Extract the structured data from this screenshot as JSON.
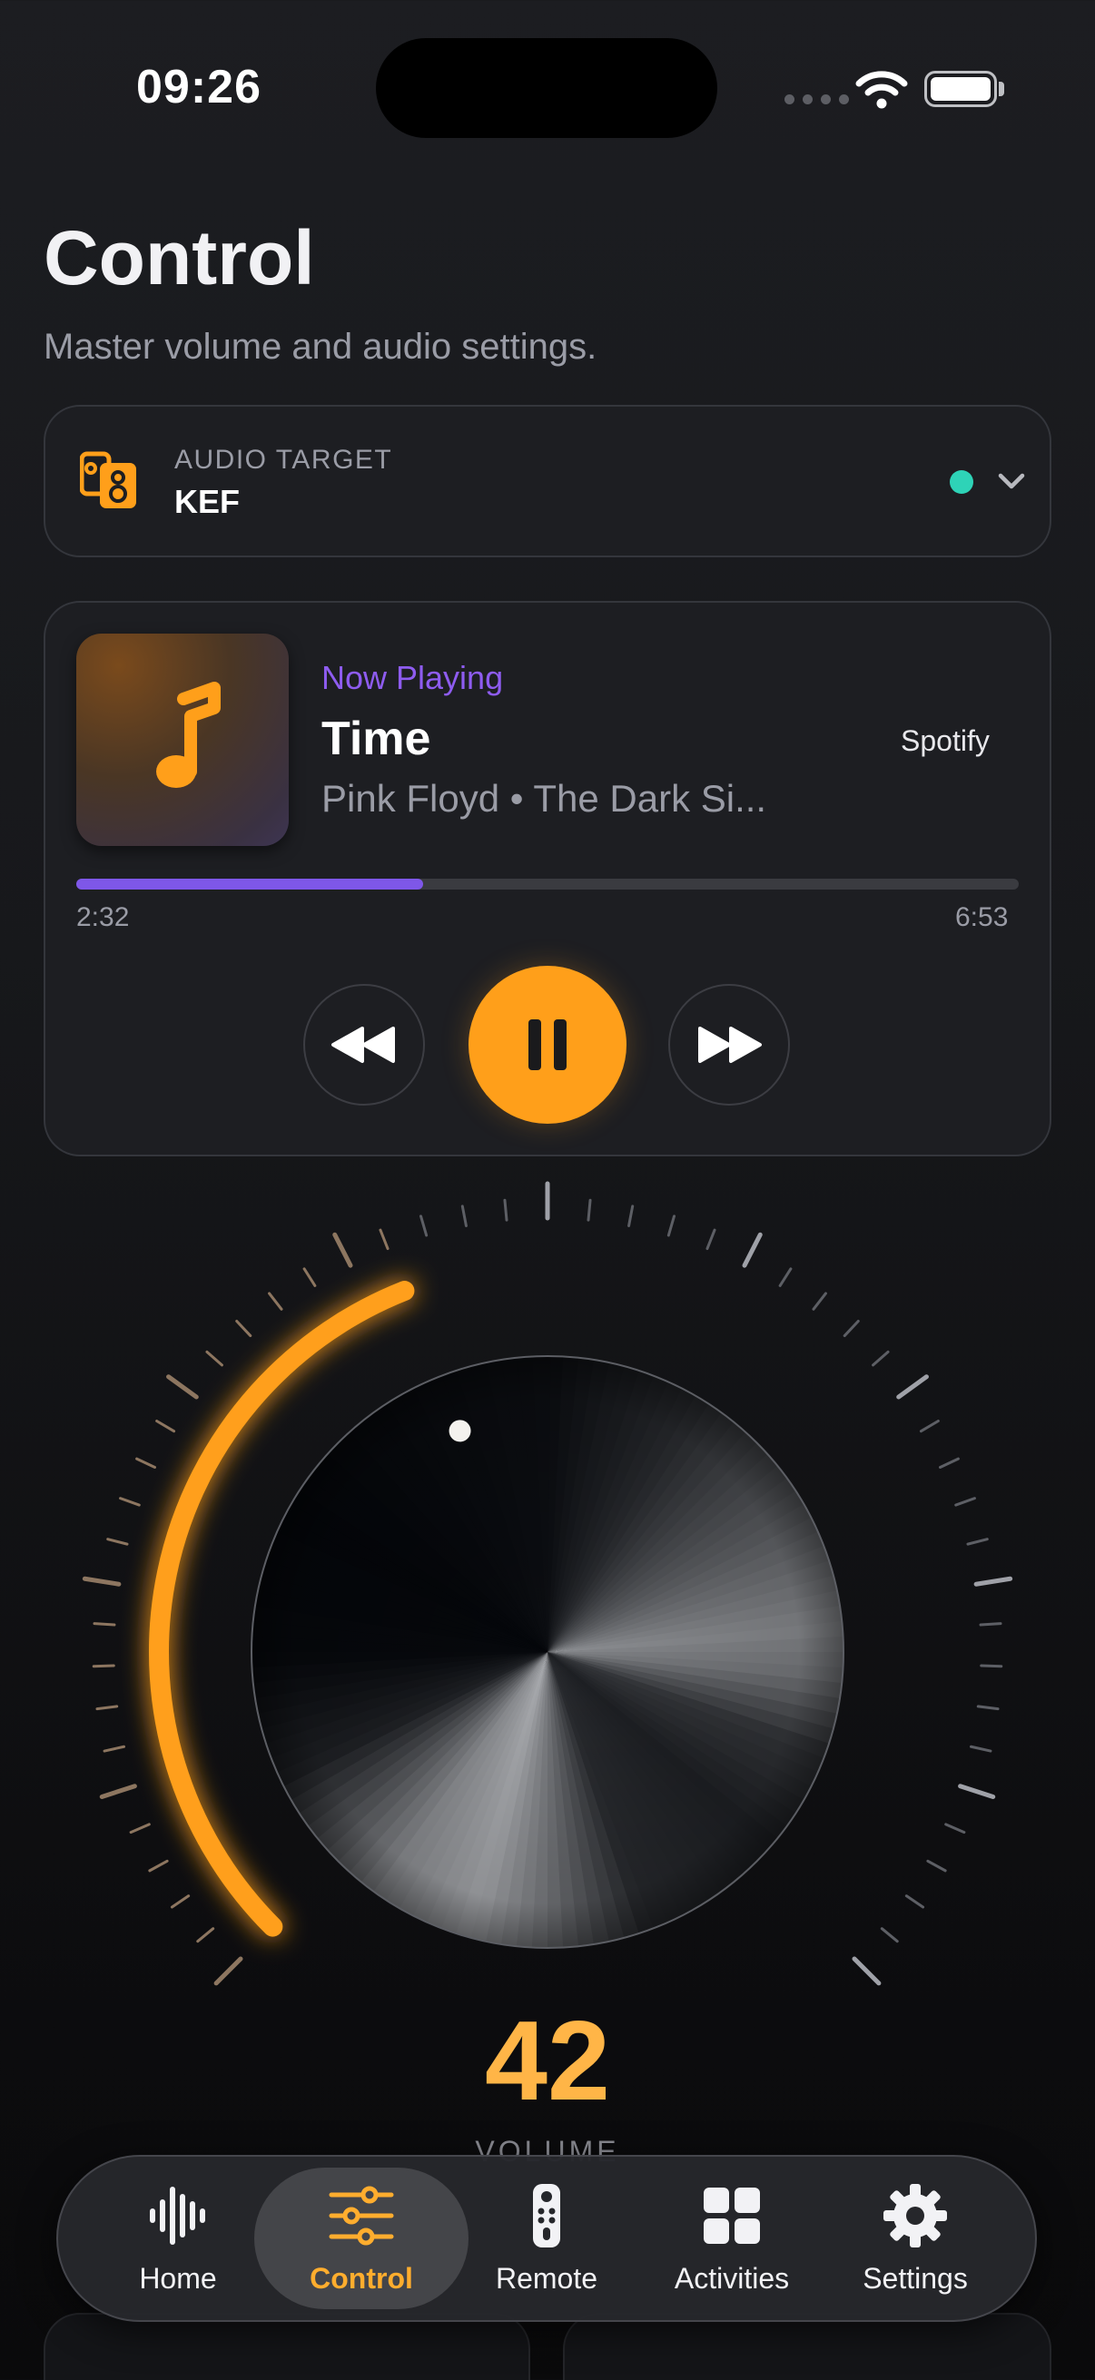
{
  "status_bar": {
    "time": "09:26"
  },
  "header": {
    "title": "Control",
    "subtitle": "Master volume and audio settings."
  },
  "audio_target": {
    "label": "AUDIO TARGET",
    "value": "KEF",
    "status_color": "#2ed3b7",
    "icon": "speaker-icon"
  },
  "now_playing": {
    "label": "Now Playing",
    "title": "Time",
    "artist_album": "Pink Floyd • The Dark Si...",
    "source": "Spotify",
    "elapsed": "2:32",
    "duration": "6:53",
    "progress_fraction": 0.368,
    "accent": "#7e57e8"
  },
  "volume": {
    "value": "42",
    "label": "VOLUME",
    "level": 42,
    "max": 100,
    "accent": "#ff9f1a"
  },
  "tabs": [
    {
      "label": "Home",
      "icon": "waveform-icon",
      "active": false
    },
    {
      "label": "Control",
      "icon": "sliders-icon",
      "active": true
    },
    {
      "label": "Remote",
      "icon": "remote-icon",
      "active": false
    },
    {
      "label": "Activities",
      "icon": "grid-icon",
      "active": false
    },
    {
      "label": "Settings",
      "icon": "gear-icon",
      "active": false
    }
  ]
}
